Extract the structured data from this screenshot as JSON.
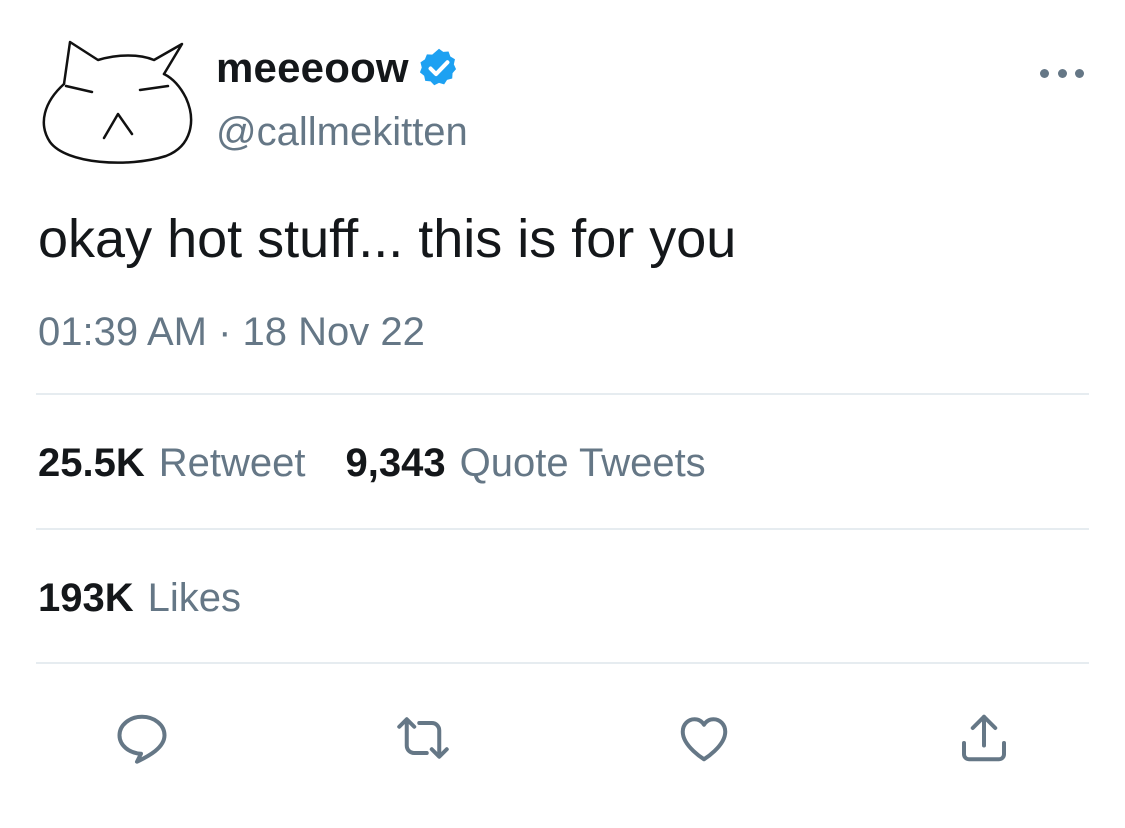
{
  "user": {
    "display_name": "meeeoow",
    "handle": "@callmekitten",
    "verified": true
  },
  "tweet": {
    "text": "okay hot stuff... this is for you",
    "timestamp": "01:39 AM · 18 Nov 22"
  },
  "stats": {
    "retweets": {
      "count": "25.5K",
      "label": "Retweet"
    },
    "quotes": {
      "count": "9,343",
      "label": "Quote Tweets"
    },
    "likes": {
      "count": "193K",
      "label": "Likes"
    }
  },
  "actions": [
    "reply-icon",
    "retweet-icon",
    "like-icon",
    "share-icon"
  ],
  "colors": {
    "text_primary": "#14171a",
    "text_secondary": "#657786",
    "verified_blue": "#1da1f2",
    "divider": "#e6ecf0"
  }
}
